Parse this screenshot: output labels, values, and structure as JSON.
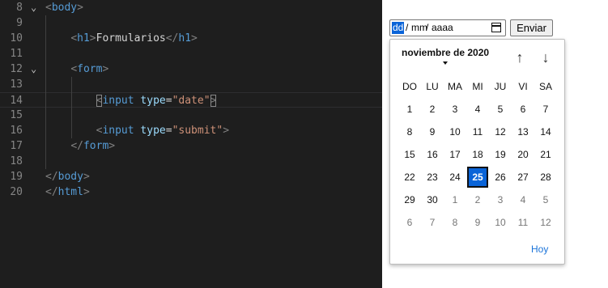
{
  "editor": {
    "lines": [
      {
        "num": "8",
        "fold": true,
        "tokens": [
          [
            "br",
            "<"
          ],
          [
            "tag",
            "body"
          ],
          [
            "br",
            ">"
          ]
        ]
      },
      {
        "num": "9",
        "fold": false,
        "tokens": []
      },
      {
        "num": "10",
        "fold": false,
        "tokens": [
          [
            "txt",
            "    "
          ],
          [
            "br",
            "<"
          ],
          [
            "tag",
            "h1"
          ],
          [
            "br",
            ">"
          ],
          [
            "txt",
            "Formularios"
          ],
          [
            "br",
            "</"
          ],
          [
            "tag",
            "h1"
          ],
          [
            "br",
            ">"
          ]
        ]
      },
      {
        "num": "11",
        "fold": false,
        "tokens": []
      },
      {
        "num": "12",
        "fold": true,
        "tokens": [
          [
            "txt",
            "    "
          ],
          [
            "br",
            "<"
          ],
          [
            "tag",
            "form"
          ],
          [
            "br",
            ">"
          ]
        ]
      },
      {
        "num": "13",
        "fold": false,
        "tokens": []
      },
      {
        "num": "14",
        "fold": false,
        "current": true,
        "tokens": [
          [
            "txt",
            "        "
          ],
          [
            "brm",
            "<"
          ],
          [
            "tag",
            "input"
          ],
          [
            "txt",
            " "
          ],
          [
            "attr",
            "type"
          ],
          [
            "eq",
            "="
          ],
          [
            "str",
            "\"date\""
          ],
          [
            "brm",
            ">"
          ]
        ]
      },
      {
        "num": "15",
        "fold": false,
        "tokens": []
      },
      {
        "num": "16",
        "fold": false,
        "tokens": [
          [
            "txt",
            "        "
          ],
          [
            "br",
            "<"
          ],
          [
            "tag",
            "input"
          ],
          [
            "txt",
            " "
          ],
          [
            "attr",
            "type"
          ],
          [
            "eq",
            "="
          ],
          [
            "str",
            "\"submit\""
          ],
          [
            "br",
            ">"
          ]
        ]
      },
      {
        "num": "17",
        "fold": false,
        "tokens": [
          [
            "txt",
            "    "
          ],
          [
            "br",
            "</"
          ],
          [
            "tag",
            "form"
          ],
          [
            "br",
            ">"
          ]
        ]
      },
      {
        "num": "18",
        "fold": false,
        "tokens": []
      },
      {
        "num": "19",
        "fold": false,
        "tokens": [
          [
            "br",
            "</"
          ],
          [
            "tag",
            "body"
          ],
          [
            "br",
            ">"
          ]
        ]
      },
      {
        "num": "20",
        "fold": false,
        "tokens": [
          [
            "br",
            "</"
          ],
          [
            "tag",
            "html"
          ],
          [
            "br",
            ">"
          ]
        ]
      }
    ]
  },
  "form": {
    "date_input": {
      "day": "dd",
      "sep1": "/",
      "month": "mm",
      "sep2": "/",
      "year": "aaaa"
    },
    "submit_label": "Enviar"
  },
  "datepicker": {
    "month_label": "noviembre de 2020",
    "nav_up": "↑",
    "nav_down": "↓",
    "weekdays": [
      "DO",
      "LU",
      "MA",
      "MI",
      "JU",
      "VI",
      "SA"
    ],
    "weeks": [
      [
        "1",
        "2",
        "3",
        "4",
        "5",
        "6",
        "7"
      ],
      [
        "8",
        "9",
        "10",
        "11",
        "12",
        "13",
        "14"
      ],
      [
        "15",
        "16",
        "17",
        "18",
        "19",
        "20",
        "21"
      ],
      [
        "22",
        "23",
        "24",
        "25",
        "26",
        "27",
        "28"
      ],
      [
        "29",
        "30",
        "1",
        "2",
        "3",
        "4",
        "5"
      ],
      [
        "6",
        "7",
        "8",
        "9",
        "10",
        "11",
        "12"
      ]
    ],
    "selected_day": "25",
    "today_button": "Hoy"
  },
  "colors": {
    "editor_bg": "#1e1e1e",
    "accent": "#0a64d8",
    "link": "#1a73d9"
  }
}
